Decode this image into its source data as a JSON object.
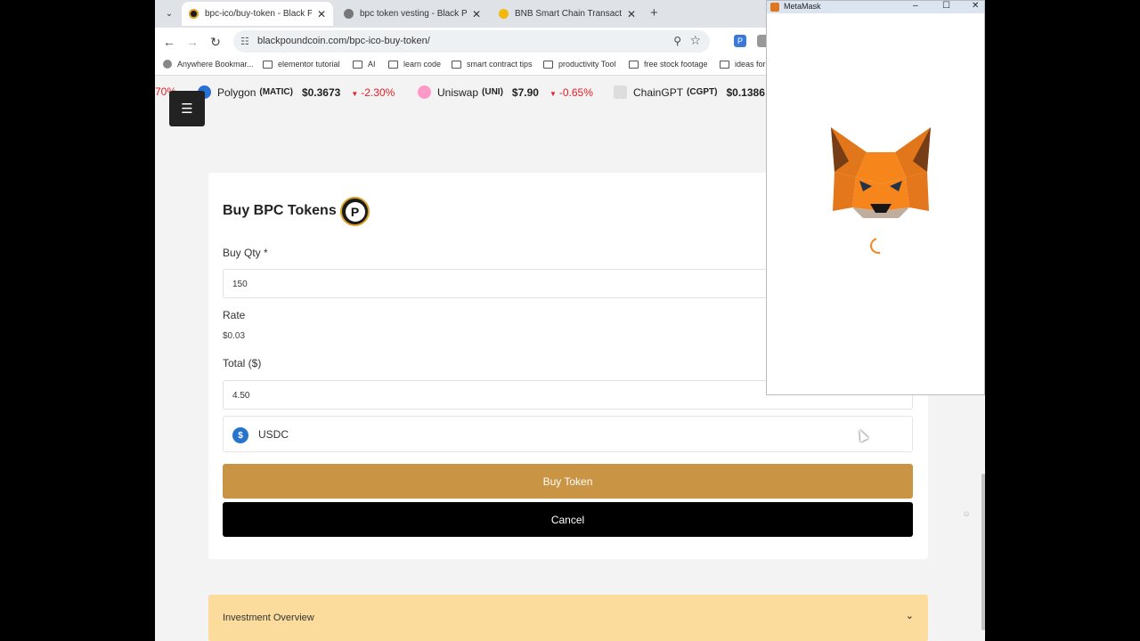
{
  "tabs": [
    {
      "title": "bpc-ico/buy-token - Black Pound",
      "favicon_color": "#1a1a1a",
      "active": true
    },
    {
      "title": "bpc token vesting - Black Pound",
      "favicon_color": "#555555",
      "active": false
    },
    {
      "title": "BNB Smart Chain Transaction H",
      "favicon_color": "#f0b90b",
      "active": false
    }
  ],
  "toolbar": {
    "url": "blackpoundcoin.com/bpc-ico-buy-token/"
  },
  "bookmarks": [
    "Anywhere Bookmar...",
    "elementor tutorial",
    "AI",
    "learn code",
    "smart contract tips",
    "productivity Tool",
    "free stock footage",
    "ideas for"
  ],
  "ticker": [
    {
      "partial_change": "70%"
    },
    {
      "name": "Polygon",
      "symbol": "(MATIC)",
      "price": "$0.3673",
      "change": "-2.30%",
      "icon_color": "#2a6fd6"
    },
    {
      "name": "Uniswap",
      "symbol": "(UNI)",
      "price": "$7.90",
      "change": "-0.65%",
      "icon_color": "#ff007a"
    },
    {
      "name": "ChainGPT",
      "symbol": "(CGPT)",
      "price": "$0.1386",
      "icon_color": "#cccccc"
    }
  ],
  "form": {
    "title": "Buy BPC Tokens",
    "logo_letter": "P",
    "qty_label": "Buy Qty *",
    "qty_value": "150",
    "rate_label": "Rate",
    "rate_value": "$0.03",
    "total_label": "Total ($)",
    "total_value": "4.50",
    "token_label": "USDC",
    "buy_label": "Buy Token",
    "cancel_label": "Cancel"
  },
  "accordion": {
    "label": "Investment Overview"
  },
  "metamask": {
    "window_title": "MetaMask"
  },
  "colors": {
    "buy_button": "#c99444",
    "cancel_button": "#000000",
    "accordion_bg": "#fbdc9c",
    "negative_change": "#e2202a",
    "usdc": "#2775ca",
    "metamask_orange": "#f6851b"
  }
}
